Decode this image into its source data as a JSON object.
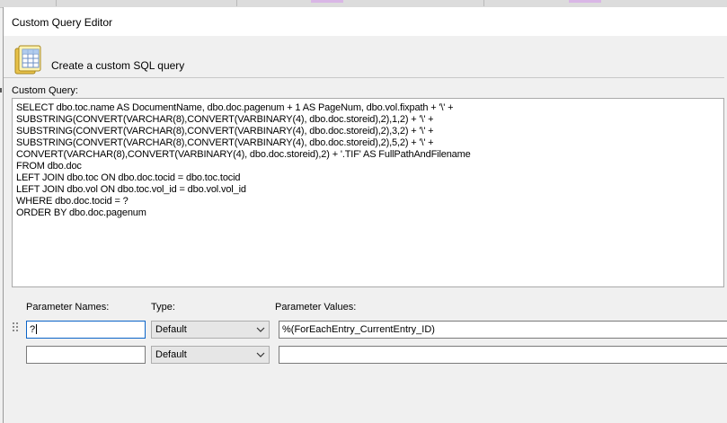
{
  "window": {
    "title": "Custom Query Editor"
  },
  "header": {
    "icon": "database-icon",
    "text": "Create a custom SQL query"
  },
  "query": {
    "label": "Custom Query:",
    "lines": [
      "SELECT dbo.toc.name AS DocumentName, dbo.doc.pagenum + 1 AS PageNum, dbo.vol.fixpath + '\\' +",
      "SUBSTRING(CONVERT(VARCHAR(8),CONVERT(VARBINARY(4), dbo.doc.storeid),2),1,2) + '\\' +",
      "SUBSTRING(CONVERT(VARCHAR(8),CONVERT(VARBINARY(4), dbo.doc.storeid),2),3,2) + '\\' +",
      "SUBSTRING(CONVERT(VARCHAR(8),CONVERT(VARBINARY(4), dbo.doc.storeid),2),5,2) + '\\' +",
      "CONVERT(VARCHAR(8),CONVERT(VARBINARY(4), dbo.doc.storeid),2) + '.TIF' AS FullPathAndFilename",
      "FROM dbo.doc",
      "LEFT JOIN dbo.toc ON dbo.doc.tocid = dbo.toc.tocid",
      "LEFT JOIN dbo.vol ON dbo.toc.vol_id = dbo.vol.vol_id",
      "WHERE dbo.doc.tocid = ?",
      "ORDER BY dbo.doc.pagenum"
    ]
  },
  "parameters": {
    "headers": {
      "names": "Parameter Names:",
      "type": "Type:",
      "values": "Parameter Values:"
    },
    "rows": [
      {
        "name": "?",
        "type": "Default",
        "value": "%(ForEachEntry_CurrentEntry_ID)"
      },
      {
        "name": "",
        "type": "Default",
        "value": ""
      }
    ]
  }
}
